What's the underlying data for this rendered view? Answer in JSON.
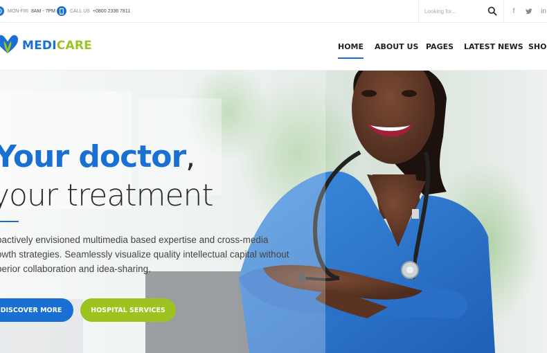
{
  "topbar": {
    "hours_label": "MON-FRI",
    "hours_value": "8AM - 7PM",
    "call_label": "CALL US",
    "call_value": "+0800 2336 7811",
    "search_placeholder": "Looking for..."
  },
  "social": {
    "facebook": "f",
    "twitter": "t",
    "linkedin": "in"
  },
  "logo": {
    "part1": "MEDI",
    "part2": "CARE"
  },
  "nav": [
    {
      "label": "HOME",
      "active": true
    },
    {
      "label": "ABOUT US"
    },
    {
      "label": "PAGES"
    },
    {
      "label": "LATEST NEWS"
    },
    {
      "label": "SHOP"
    }
  ],
  "hero": {
    "headline_strong": "Your doctor",
    "headline_comma": ",",
    "headline_light": "your treatment",
    "description_lines": [
      "oactively envisioned multimedia based expertise and cross-media",
      "owth strategies. Seamlessly visualize quality intellectual capital without",
      "perior collaboration and idea-sharing."
    ],
    "primary_button": "DISCOVER MORE",
    "secondary_button": "HOSPITAL SERVICES"
  },
  "colors": {
    "brand_blue": "#1a6fd2",
    "brand_green": "#9cc31f"
  },
  "icons": [
    "clock-icon",
    "phone-icon",
    "search-icon",
    "facebook-icon",
    "twitter-icon",
    "linkedin-icon",
    "logo-icon"
  ]
}
